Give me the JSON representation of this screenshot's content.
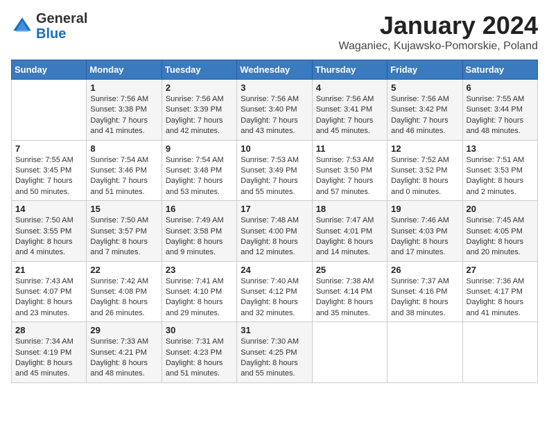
{
  "logo": {
    "general": "General",
    "blue": "Blue"
  },
  "title": "January 2024",
  "subtitle": "Waganiec, Kujawsko-Pomorskie, Poland",
  "days_of_week": [
    "Sunday",
    "Monday",
    "Tuesday",
    "Wednesday",
    "Thursday",
    "Friday",
    "Saturday"
  ],
  "weeks": [
    [
      {
        "day": "",
        "info": ""
      },
      {
        "day": "1",
        "info": "Sunrise: 7:56 AM\nSunset: 3:38 PM\nDaylight: 7 hours\nand 41 minutes."
      },
      {
        "day": "2",
        "info": "Sunrise: 7:56 AM\nSunset: 3:39 PM\nDaylight: 7 hours\nand 42 minutes."
      },
      {
        "day": "3",
        "info": "Sunrise: 7:56 AM\nSunset: 3:40 PM\nDaylight: 7 hours\nand 43 minutes."
      },
      {
        "day": "4",
        "info": "Sunrise: 7:56 AM\nSunset: 3:41 PM\nDaylight: 7 hours\nand 45 minutes."
      },
      {
        "day": "5",
        "info": "Sunrise: 7:56 AM\nSunset: 3:42 PM\nDaylight: 7 hours\nand 46 minutes."
      },
      {
        "day": "6",
        "info": "Sunrise: 7:55 AM\nSunset: 3:44 PM\nDaylight: 7 hours\nand 48 minutes."
      }
    ],
    [
      {
        "day": "7",
        "info": "Sunrise: 7:55 AM\nSunset: 3:45 PM\nDaylight: 7 hours\nand 50 minutes."
      },
      {
        "day": "8",
        "info": "Sunrise: 7:54 AM\nSunset: 3:46 PM\nDaylight: 7 hours\nand 51 minutes."
      },
      {
        "day": "9",
        "info": "Sunrise: 7:54 AM\nSunset: 3:48 PM\nDaylight: 7 hours\nand 53 minutes."
      },
      {
        "day": "10",
        "info": "Sunrise: 7:53 AM\nSunset: 3:49 PM\nDaylight: 7 hours\nand 55 minutes."
      },
      {
        "day": "11",
        "info": "Sunrise: 7:53 AM\nSunset: 3:50 PM\nDaylight: 7 hours\nand 57 minutes."
      },
      {
        "day": "12",
        "info": "Sunrise: 7:52 AM\nSunset: 3:52 PM\nDaylight: 8 hours\nand 0 minutes."
      },
      {
        "day": "13",
        "info": "Sunrise: 7:51 AM\nSunset: 3:53 PM\nDaylight: 8 hours\nand 2 minutes."
      }
    ],
    [
      {
        "day": "14",
        "info": "Sunrise: 7:50 AM\nSunset: 3:55 PM\nDaylight: 8 hours\nand 4 minutes."
      },
      {
        "day": "15",
        "info": "Sunrise: 7:50 AM\nSunset: 3:57 PM\nDaylight: 8 hours\nand 7 minutes."
      },
      {
        "day": "16",
        "info": "Sunrise: 7:49 AM\nSunset: 3:58 PM\nDaylight: 8 hours\nand 9 minutes."
      },
      {
        "day": "17",
        "info": "Sunrise: 7:48 AM\nSunset: 4:00 PM\nDaylight: 8 hours\nand 12 minutes."
      },
      {
        "day": "18",
        "info": "Sunrise: 7:47 AM\nSunset: 4:01 PM\nDaylight: 8 hours\nand 14 minutes."
      },
      {
        "day": "19",
        "info": "Sunrise: 7:46 AM\nSunset: 4:03 PM\nDaylight: 8 hours\nand 17 minutes."
      },
      {
        "day": "20",
        "info": "Sunrise: 7:45 AM\nSunset: 4:05 PM\nDaylight: 8 hours\nand 20 minutes."
      }
    ],
    [
      {
        "day": "21",
        "info": "Sunrise: 7:43 AM\nSunset: 4:07 PM\nDaylight: 8 hours\nand 23 minutes."
      },
      {
        "day": "22",
        "info": "Sunrise: 7:42 AM\nSunset: 4:08 PM\nDaylight: 8 hours\nand 26 minutes."
      },
      {
        "day": "23",
        "info": "Sunrise: 7:41 AM\nSunset: 4:10 PM\nDaylight: 8 hours\nand 29 minutes."
      },
      {
        "day": "24",
        "info": "Sunrise: 7:40 AM\nSunset: 4:12 PM\nDaylight: 8 hours\nand 32 minutes."
      },
      {
        "day": "25",
        "info": "Sunrise: 7:38 AM\nSunset: 4:14 PM\nDaylight: 8 hours\nand 35 minutes."
      },
      {
        "day": "26",
        "info": "Sunrise: 7:37 AM\nSunset: 4:16 PM\nDaylight: 8 hours\nand 38 minutes."
      },
      {
        "day": "27",
        "info": "Sunrise: 7:36 AM\nSunset: 4:17 PM\nDaylight: 8 hours\nand 41 minutes."
      }
    ],
    [
      {
        "day": "28",
        "info": "Sunrise: 7:34 AM\nSunset: 4:19 PM\nDaylight: 8 hours\nand 45 minutes."
      },
      {
        "day": "29",
        "info": "Sunrise: 7:33 AM\nSunset: 4:21 PM\nDaylight: 8 hours\nand 48 minutes."
      },
      {
        "day": "30",
        "info": "Sunrise: 7:31 AM\nSunset: 4:23 PM\nDaylight: 8 hours\nand 51 minutes."
      },
      {
        "day": "31",
        "info": "Sunrise: 7:30 AM\nSunset: 4:25 PM\nDaylight: 8 hours\nand 55 minutes."
      },
      {
        "day": "",
        "info": ""
      },
      {
        "day": "",
        "info": ""
      },
      {
        "day": "",
        "info": ""
      }
    ]
  ]
}
